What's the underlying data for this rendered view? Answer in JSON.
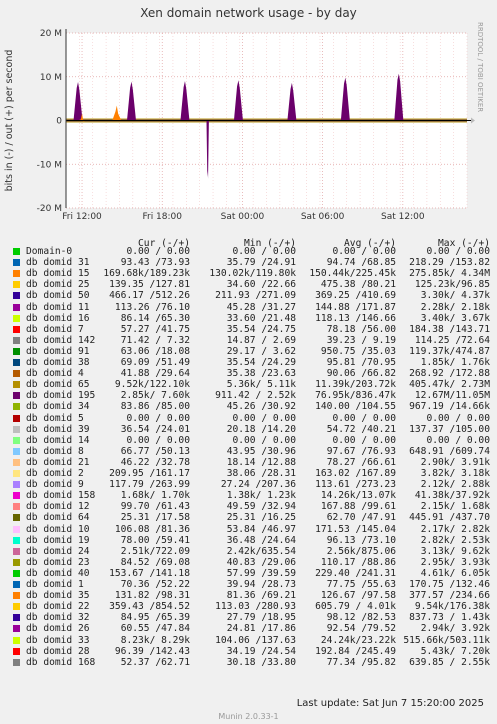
{
  "chart_data": {
    "type": "area",
    "title": "Xen domain network usage - by day",
    "ylabel": "bits in (-) / out (+) per second",
    "ylim": [
      -20000000,
      20000000
    ],
    "yticks": [
      {
        "v": 20000000,
        "label": "20 M"
      },
      {
        "v": 10000000,
        "label": "10 M"
      },
      {
        "v": 0,
        "label": "0"
      },
      {
        "v": -10000000,
        "label": "-10 M"
      },
      {
        "v": -20000000,
        "label": "-20 M"
      }
    ],
    "xticks": [
      "Fri 12:00",
      "Fri 18:00",
      "Sat 00:00",
      "Sat 06:00",
      "Sat 12:00"
    ],
    "grid": true,
    "series_summary": "Stacked per-domain traffic; near zero except periodic out spikes",
    "spikes": [
      {
        "series": "db domid 195",
        "x_hours": 0.9,
        "value": 8800000
      },
      {
        "series": "db domid 195",
        "x_hours": 4.9,
        "value": 8900000
      },
      {
        "series": "db domid 195",
        "x_hours": 8.9,
        "value": 9000000
      },
      {
        "series": "db domid 195",
        "x_hours": 12.9,
        "value": 9200000
      },
      {
        "series": "db domid 195",
        "x_hours": 16.9,
        "value": 8600000
      },
      {
        "series": "db domid 195",
        "x_hours": 20.9,
        "value": 9800000
      },
      {
        "series": "db domid 195",
        "x_hours": 24.9,
        "value": 10700000
      },
      {
        "series": "db domid 15",
        "x_hours": 3.8,
        "value": 3400000
      },
      {
        "series": "db domid 15",
        "x_hours": 1.2,
        "value": 1600000
      },
      {
        "series": "db domid 195",
        "x_hours": 10.6,
        "value": -11500000
      }
    ]
  },
  "rrd_label": "RRDTOOL / TOBI OETIKER",
  "legend": {
    "headers": {
      "cur": "Cur (-/+)",
      "min": "Min (-/+)",
      "avg": "Avg (-/+)",
      "max": "Max (-/+)"
    },
    "rows": [
      {
        "name": "Domain-0",
        "color": "#00cc00",
        "cur": "0.00 / 0.00",
        "min": "0.00 / 0.00",
        "avg": "0.00 / 0.00",
        "max": "0.00 / 0.00"
      },
      {
        "name": "db domid 31",
        "color": "#0066b3",
        "cur": "93.43 /73.93",
        "min": "35.79 /24.91",
        "avg": "94.74 /68.85",
        "max": "218.29 /153.82"
      },
      {
        "name": "db domid 15",
        "color": "#ff8000",
        "cur": "169.68k/189.23k",
        "min": "130.02k/119.80k",
        "avg": "150.44k/225.45k",
        "max": "275.85k/ 4.34M"
      },
      {
        "name": "db domid 25",
        "color": "#ffcc00",
        "cur": "139.35 /127.81",
        "min": "34.60 /22.66",
        "avg": "475.38 /80.21",
        "max": "125.23k/96.85"
      },
      {
        "name": "db domid 50",
        "color": "#330099",
        "cur": "466.17 /512.26",
        "min": "211.93 /271.09",
        "avg": "369.25 /410.69",
        "max": "3.30k/ 4.37k"
      },
      {
        "name": "db domid 11",
        "color": "#990099",
        "cur": "113.26 /76.10",
        "min": "45.28 /31.27",
        "avg": "144.88 /171.87",
        "max": "2.28k/ 2.18k"
      },
      {
        "name": "db domid 16",
        "color": "#ccff00",
        "cur": "86.14 /65.30",
        "min": "33.60 /21.48",
        "avg": "118.13 /146.66",
        "max": "3.40k/ 3.67k"
      },
      {
        "name": "db domid 7",
        "color": "#ff0000",
        "cur": "57.27 /41.75",
        "min": "35.54 /24.75",
        "avg": "78.18 /56.00",
        "max": "184.38 /143.71"
      },
      {
        "name": "db domid 142",
        "color": "#808080",
        "cur": "71.42 / 7.32",
        "min": "14.87 / 2.69",
        "avg": "39.23 / 9.19",
        "max": "114.25 /72.64"
      },
      {
        "name": "db domid 91",
        "color": "#008f00",
        "cur": "63.06 /18.08",
        "min": "29.17 / 3.62",
        "avg": "950.75 /35.03",
        "max": "119.37k/474.87"
      },
      {
        "name": "db domid 38",
        "color": "#00487d",
        "cur": "69.09 /51.49",
        "min": "35.54 /24.29",
        "avg": "95.81 /70.95",
        "max": "1.85k/ 1.76k"
      },
      {
        "name": "db domid 4",
        "color": "#b35a00",
        "cur": "41.88 /29.64",
        "min": "35.38 /23.63",
        "avg": "90.06 /66.82",
        "max": "268.92 /172.88"
      },
      {
        "name": "db domid 65",
        "color": "#b38f00",
        "cur": "9.52k/122.10k",
        "min": "5.36k/ 5.11k",
        "avg": "11.39k/203.72k",
        "max": "405.47k/ 2.73M"
      },
      {
        "name": "db domid 195",
        "color": "#6b006b",
        "cur": "2.85k/ 7.60k",
        "min": "911.42 / 2.52k",
        "avg": "76.95k/836.47k",
        "max": "12.67M/11.05M"
      },
      {
        "name": "db domid 34",
        "color": "#8fb300",
        "cur": "83.86 /85.00",
        "min": "45.26 /30.92",
        "avg": "140.00 /104.55",
        "max": "967.19 /14.66k"
      },
      {
        "name": "db domid 5",
        "color": "#b30000",
        "cur": "0.00 / 0.00",
        "min": "0.00 / 0.00",
        "avg": "0.00 / 0.00",
        "max": "0.00 / 0.00"
      },
      {
        "name": "db domid 39",
        "color": "#bebebe",
        "cur": "36.54 /24.01",
        "min": "20.18 /14.20",
        "avg": "54.72 /40.21",
        "max": "137.37 /105.00"
      },
      {
        "name": "db domid 14",
        "color": "#80ff80",
        "cur": "0.00 / 0.00",
        "min": "0.00 / 0.00",
        "avg": "0.00 / 0.00",
        "max": "0.00 / 0.00"
      },
      {
        "name": "db domid 8",
        "color": "#80c9ff",
        "cur": "66.77 /50.13",
        "min": "43.95 /30.96",
        "avg": "97.67 /76.93",
        "max": "648.91 /609.74"
      },
      {
        "name": "db domid 21",
        "color": "#ffc080",
        "cur": "46.22 /32.78",
        "min": "18.14 /12.88",
        "avg": "78.27 /66.61",
        "max": "2.90k/ 3.91k"
      },
      {
        "name": "db domid 2",
        "color": "#ffe680",
        "cur": "209.95 /161.17",
        "min": "38.06 /28.31",
        "avg": "163.02 /167.89",
        "max": "3.82k/ 3.18k"
      },
      {
        "name": "db domid 9",
        "color": "#aa80ff",
        "cur": "117.79 /263.99",
        "min": "27.24 /207.36",
        "avg": "113.61 /273.23",
        "max": "2.12k/ 2.88k"
      },
      {
        "name": "db domid 158",
        "color": "#ee00cc",
        "cur": "1.68k/ 1.70k",
        "min": "1.38k/ 1.23k",
        "avg": "14.26k/13.07k",
        "max": "41.38k/37.92k"
      },
      {
        "name": "db domid 12",
        "color": "#ff8080",
        "cur": "99.70 /61.43",
        "min": "49.59 /32.94",
        "avg": "167.88 /99.61",
        "max": "2.15k/ 1.68k"
      },
      {
        "name": "db domid 64",
        "color": "#666600",
        "cur": "25.31 /17.58",
        "min": "25.31 /16.25",
        "avg": "62.70 /47.91",
        "max": "445.91 /437.70"
      },
      {
        "name": "db domid 10",
        "color": "#ffbfff",
        "cur": "106.08 /81.36",
        "min": "53.84 /46.97",
        "avg": "171.53 /145.04",
        "max": "2.17k/ 2.82k"
      },
      {
        "name": "db domid 19",
        "color": "#00ffcc",
        "cur": "78.00 /59.41",
        "min": "36.48 /24.64",
        "avg": "96.13 /73.10",
        "max": "2.82k/ 2.53k"
      },
      {
        "name": "db domid 24",
        "color": "#cc6699",
        "cur": "2.51k/722.09",
        "min": "2.42k/635.54",
        "avg": "2.56k/875.06",
        "max": "3.13k/ 9.62k"
      },
      {
        "name": "db domid 23",
        "color": "#999900",
        "cur": "84.52 /69.08",
        "min": "40.83 /29.06",
        "avg": "110.17 /88.86",
        "max": "2.95k/ 3.93k"
      },
      {
        "name": "db domid 40",
        "color": "#00cc00",
        "cur": "153.67 /141.18",
        "min": "57.99 /39.59",
        "avg": "229.40 /241.31",
        "max": "4.61k/ 6.05k"
      },
      {
        "name": "db domid 1",
        "color": "#0066b3",
        "cur": "70.36 /52.22",
        "min": "39.94 /28.73",
        "avg": "77.75 /55.63",
        "max": "170.75 /132.46"
      },
      {
        "name": "db domid 35",
        "color": "#ff8000",
        "cur": "131.82 /98.31",
        "min": "81.36 /69.21",
        "avg": "126.67 /97.58",
        "max": "377.57 /234.66"
      },
      {
        "name": "db domid 22",
        "color": "#ffcc00",
        "cur": "359.43 /854.52",
        "min": "113.03 /280.93",
        "avg": "605.79 / 4.01k",
        "max": "9.54k/176.38k"
      },
      {
        "name": "db domid 32",
        "color": "#330099",
        "cur": "84.95 /65.39",
        "min": "27.79 /18.95",
        "avg": "98.12 /82.53",
        "max": "837.73 / 1.43k"
      },
      {
        "name": "db domid 26",
        "color": "#990099",
        "cur": "60.55 /47.84",
        "min": "24.81 /17.86",
        "avg": "92.54 /79.52",
        "max": "2.94k/ 3.92k"
      },
      {
        "name": "db domid 33",
        "color": "#ccff00",
        "cur": "8.23k/ 8.29k",
        "min": "104.06 /137.63",
        "avg": "24.24k/23.22k",
        "max": "515.66k/503.11k"
      },
      {
        "name": "db domid 28",
        "color": "#ff0000",
        "cur": "96.39 /142.43",
        "min": "34.19 /24.54",
        "avg": "192.84 /245.49",
        "max": "5.43k/ 7.20k"
      },
      {
        "name": "db domid 168",
        "color": "#808080",
        "cur": "52.37 /62.71",
        "min": "30.18 /33.80",
        "avg": "77.34 /95.82",
        "max": "639.85 / 2.55k"
      }
    ]
  },
  "footer": {
    "last_update": "Last update: Sat Jun  7 15:20:00 2025",
    "munin": "Munin 2.0.33-1"
  }
}
